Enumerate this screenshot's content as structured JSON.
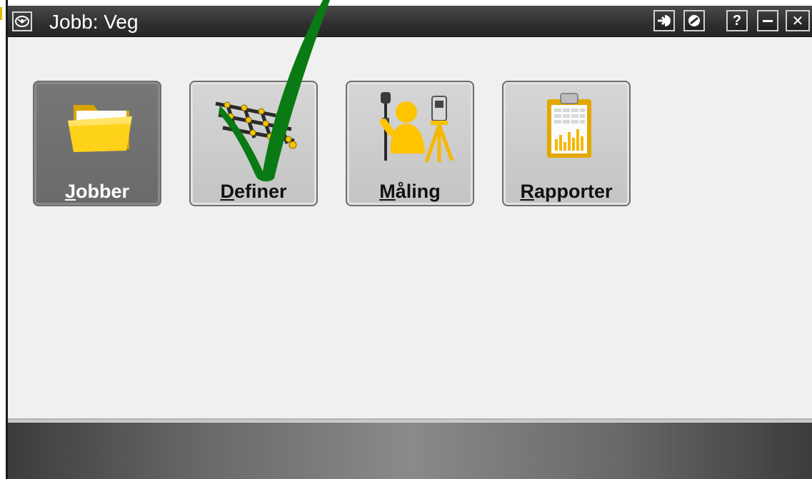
{
  "window": {
    "title": "Jobb: Veg"
  },
  "titlebar_buttons": [
    {
      "name": "login-arrow-icon"
    },
    {
      "name": "stop-icon"
    },
    {
      "name": "help-icon",
      "label": "?"
    },
    {
      "name": "minimize-icon"
    },
    {
      "name": "close-icon",
      "label": "✕"
    }
  ],
  "menu": {
    "tiles": [
      {
        "hotkey": "J",
        "rest": "obber",
        "icon": "folder-icon",
        "selected": true
      },
      {
        "hotkey": "D",
        "rest": "efiner",
        "icon": "grid-network-icon",
        "selected": false
      },
      {
        "hotkey": "M",
        "rest": "åling",
        "icon": "surveyor-instrument-icon",
        "selected": false
      },
      {
        "hotkey": "R",
        "rest": "apporter",
        "icon": "report-clipboard-icon",
        "selected": false
      }
    ]
  },
  "colors": {
    "titlebar": "#2f2f2f",
    "content_bg": "#f0f0f0",
    "tile_selected": "#707070",
    "tile_normal": "#cccccc",
    "annotation_check": "#0a7a14",
    "icon_yellow": "#f5c400"
  }
}
